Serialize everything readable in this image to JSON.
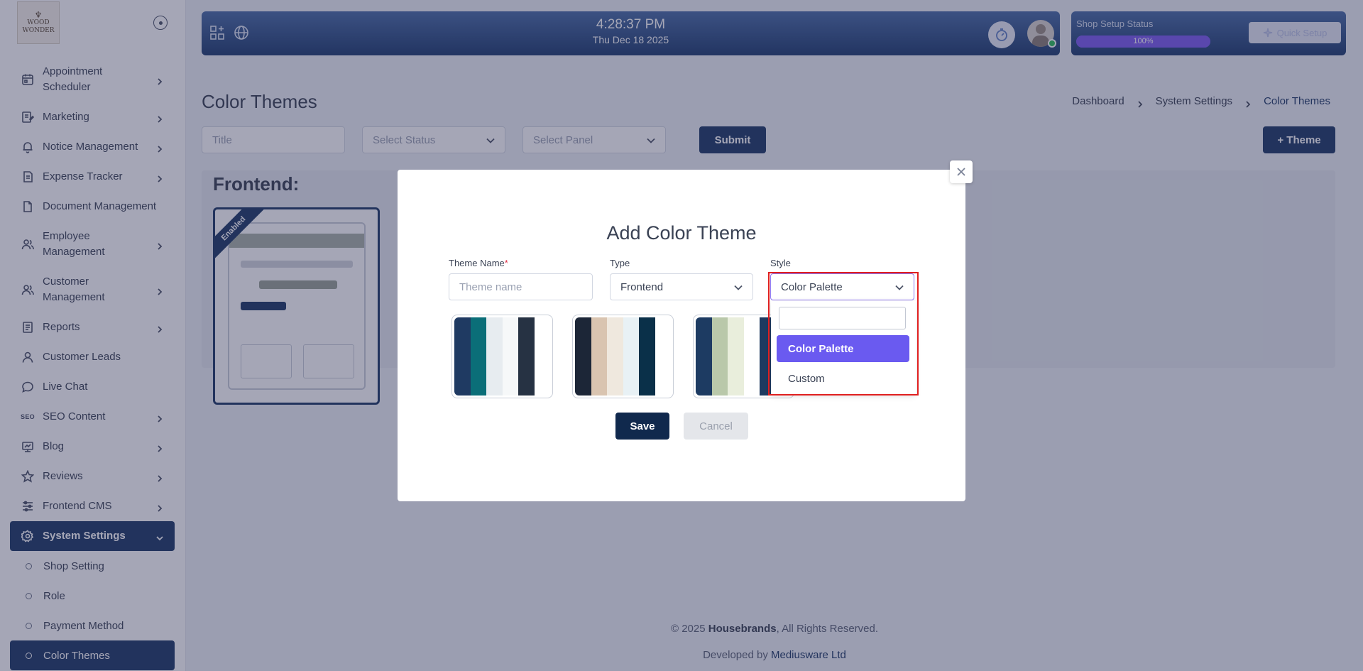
{
  "logo": {
    "line1": "WOOD",
    "line2": "WONDER"
  },
  "sidebar": {
    "items": [
      {
        "label": "Appointment Scheduler",
        "icon": "calendar-icon",
        "has_children": true
      },
      {
        "label": "Marketing",
        "icon": "marketing-icon",
        "has_children": true
      },
      {
        "label": "Notice Management",
        "icon": "bell-icon",
        "has_children": true
      },
      {
        "label": "Expense Tracker",
        "icon": "receipt-icon",
        "has_children": true
      },
      {
        "label": "Document Management",
        "icon": "document-icon",
        "has_children": false
      },
      {
        "label": "Employee Management",
        "icon": "users-icon",
        "has_children": true
      },
      {
        "label": "Customer Management",
        "icon": "users-icon",
        "has_children": true
      },
      {
        "label": "Reports",
        "icon": "report-icon",
        "has_children": true
      },
      {
        "label": "Customer Leads",
        "icon": "user-icon",
        "has_children": false
      },
      {
        "label": "Live Chat",
        "icon": "chat-icon",
        "has_children": false
      },
      {
        "label": "SEO Content",
        "icon": "seo-icon",
        "icon_text": "SEO",
        "has_children": true
      },
      {
        "label": "Blog",
        "icon": "blog-icon",
        "has_children": true
      },
      {
        "label": "Reviews",
        "icon": "star-icon",
        "has_children": true
      },
      {
        "label": "Frontend CMS",
        "icon": "sliders-icon",
        "has_children": true
      },
      {
        "label": "System Settings",
        "icon": "gear-icon",
        "has_children": true,
        "active": true
      }
    ],
    "sub_items": [
      {
        "label": "Shop Setting"
      },
      {
        "label": "Role"
      },
      {
        "label": "Payment Method"
      },
      {
        "label": "Color Themes",
        "active": true
      }
    ]
  },
  "topbar": {
    "time": "4:28:37 PM",
    "date": "Thu Dec 18 2025"
  },
  "setup": {
    "label": "Shop Setup Status",
    "progress": 100,
    "progress_text": "100%",
    "quick_setup": "Quick Setup"
  },
  "page": {
    "title": "Color Themes",
    "breadcrumb": [
      "Dashboard",
      "System Settings",
      "Color Themes"
    ]
  },
  "filters": {
    "title_placeholder": "Title",
    "status_placeholder": "Select Status",
    "panel_placeholder": "Select Panel",
    "submit": "Submit",
    "add_theme": "+ Theme"
  },
  "section": {
    "title": "Frontend:",
    "ribbon": "Enabled"
  },
  "modal": {
    "title": "Add Color Theme",
    "theme_name_label": "Theme Name",
    "required_mark": "*",
    "theme_name_placeholder": "Theme name",
    "type_label": "Type",
    "type_value": "Frontend",
    "style_label": "Style",
    "style_value": "Color Palette",
    "save": "Save",
    "cancel": "Cancel",
    "palettes": [
      [
        "#1f3a62",
        "#0b6e78",
        "#e7ecf0",
        "#f6f8f9",
        "#263243",
        "#ffffff"
      ],
      [
        "#1c2637",
        "#d9c4b0",
        "#efe8de",
        "#e8f1f5",
        "#0a3049",
        "#ffffff"
      ],
      [
        "#1d3b62",
        "#b9c8aa",
        "#e9eedc",
        "#ffffff",
        "#1e3a60",
        "#ffffff"
      ]
    ]
  },
  "dropdown": {
    "search_value": "",
    "options": [
      "Color Palette",
      "Custom"
    ],
    "selected": "Color Palette"
  },
  "footer": {
    "copyright_prefix": "© 2025 ",
    "company": "Housebrands",
    "copyright_suffix": ", All Rights Reserved.",
    "developed_by": "Developed by ",
    "developer": "Mediusware Ltd"
  },
  "colors": {
    "primary": "#1e3a66",
    "accent": "#6a5af0",
    "highlight": "#e02020"
  }
}
